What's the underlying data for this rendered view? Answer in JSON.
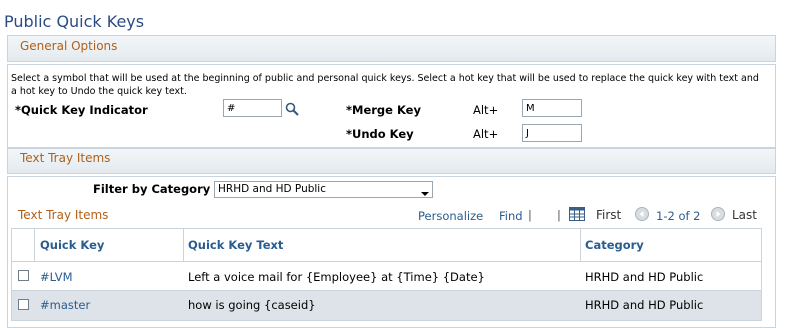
{
  "page": {
    "title": "Public Quick Keys"
  },
  "general": {
    "section_label": "General Options",
    "description": "Select a symbol that will be used at the beginning of public and personal quick keys. Select a hot key that will be used to replace the quick key with text and a hot key to Undo the quick key text.",
    "indicator_label": "*Quick Key Indicator",
    "indicator_value": "#",
    "merge_label": "*Merge Key",
    "merge_prefix": "Alt+",
    "merge_value": "M",
    "undo_label": "*Undo Key",
    "undo_prefix": "Alt+",
    "undo_value": "J"
  },
  "tray": {
    "section_label": "Text Tray Items",
    "filter_label": "Filter by Category",
    "filter_value": "HRHD and HD Public",
    "grid_title": "Text Tray Items",
    "personalize": "Personalize",
    "find": "Find",
    "sep1": "|",
    "sep2": "|",
    "first": "First",
    "range": "1-2 of 2",
    "last": "Last",
    "columns": {
      "quick_key": "Quick Key",
      "text": "Quick Key Text",
      "category": "Category"
    },
    "rows": [
      {
        "quick_key": "#LVM",
        "text": "Left a voice mail for {Employee} at {Time} {Date}",
        "category": "HRHD and HD Public"
      },
      {
        "quick_key": "#master",
        "text": "how is going {caseid}",
        "category": "HRHD and HD Public"
      }
    ]
  },
  "colors": {
    "title": "#2b4b83",
    "section_label": "#b0601a",
    "link": "#2a5d8f",
    "row_alt": "#dde3e8"
  },
  "icons": [
    "search-icon",
    "download-icon",
    "prev-arrow-icon",
    "next-arrow-icon",
    "dropdown-arrow-icon",
    "checkbox"
  ]
}
